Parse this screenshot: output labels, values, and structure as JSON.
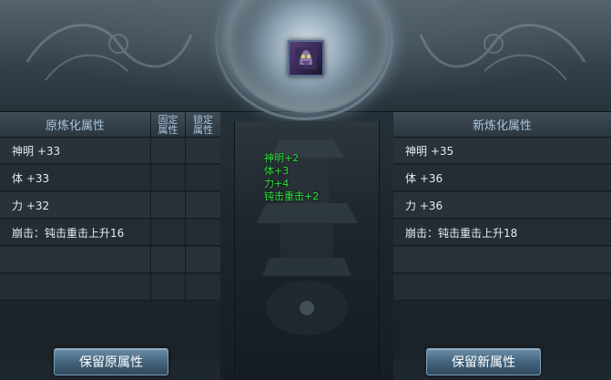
{
  "left_panel": {
    "title": "原炼化属性",
    "col_fixed": [
      "固定",
      "属性"
    ],
    "col_lock": [
      "锁定",
      "属性"
    ],
    "rows": [
      "神明 +33",
      "体 +33",
      "力 +32",
      "崩击：钝击重击上升16",
      "",
      ""
    ]
  },
  "right_panel": {
    "title": "新炼化属性",
    "rows": [
      "神明 +35",
      "体 +36",
      "力 +36",
      "崩击：钝击重击上升18",
      "",
      ""
    ]
  },
  "center_panel": {
    "bonus_lines": [
      "神明+2",
      "体+3",
      "力+4",
      "钝击重击+2"
    ]
  },
  "buttons": {
    "keep_original": "保留原属性",
    "keep_new": "保留新属性"
  },
  "item_slot": {
    "icon": "dragon-armor-icon"
  },
  "colors": {
    "bonus_text": "#31e13a",
    "header_text": "#a9c4dc",
    "button_fill": "#44647d"
  }
}
